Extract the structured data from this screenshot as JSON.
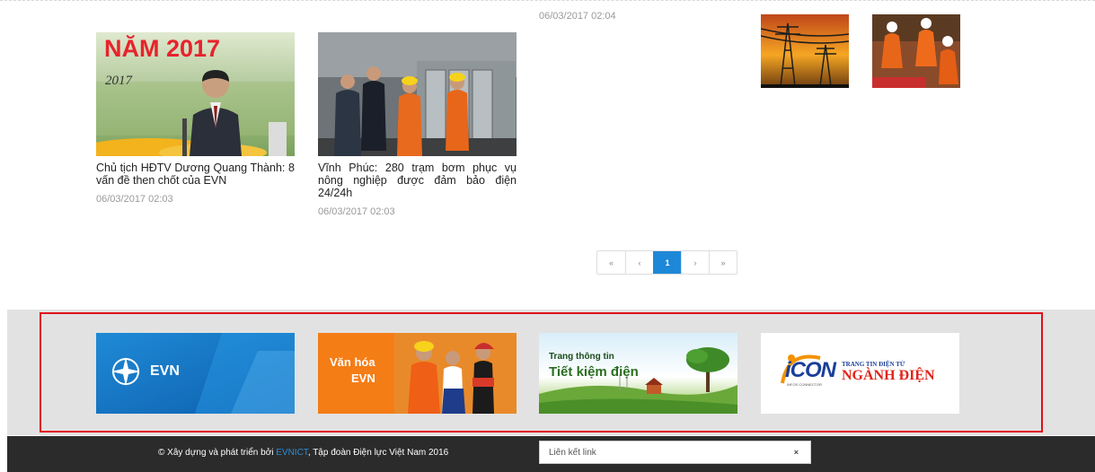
{
  "news": [
    {
      "title": "Chủ tịch HĐTV Dương Quang Thành: 8 vấn đề then chốt của EVN",
      "date": "06/03/2017 02:03",
      "image_text": {
        "heading": "NĂM 2017",
        "subheading": "2017"
      }
    },
    {
      "title": "Vĩnh Phúc: 280 trạm bơm phục vụ nông nghiệp được đảm bảo điện 24/24h",
      "date": "06/03/2017 02:03"
    }
  ],
  "orphan_date": "06/03/2017 02:04",
  "pagination": {
    "first": "«",
    "prev": "‹",
    "current": "1",
    "next": "›",
    "last": "»"
  },
  "banners": [
    {
      "name": "EVN",
      "text": "EVN"
    },
    {
      "name": "Văn hóa EVN",
      "line1": "Văn hóa",
      "line2": "EVN"
    },
    {
      "name": "Trang thông tin Tiết kiệm điện",
      "line1": "Trang thông tin",
      "line2": "Tiết kiệm điện"
    },
    {
      "name": "iCON Trang tin điện tử ngành điện",
      "logo": "iCON",
      "small1": "TRANG TIN ĐIỆN TỬ",
      "big": "NGÀNH ĐIỆN",
      "tag": "INFOS CONNECTOR"
    }
  ],
  "footer": {
    "prefix": "© Xây dựng và phát triển bởi ",
    "link": "EVNICT",
    "suffix": ", Tập đoàn Điện lực Việt Nam 2016",
    "select_placeholder": "Liên kết link",
    "select_clear": "×"
  },
  "colors": {
    "accent": "#1e88d8",
    "highlight_border": "#e0101a",
    "footer_bg": "#2b2b2b",
    "band_bg": "#e2e2e2",
    "link": "#2c8cd6"
  }
}
